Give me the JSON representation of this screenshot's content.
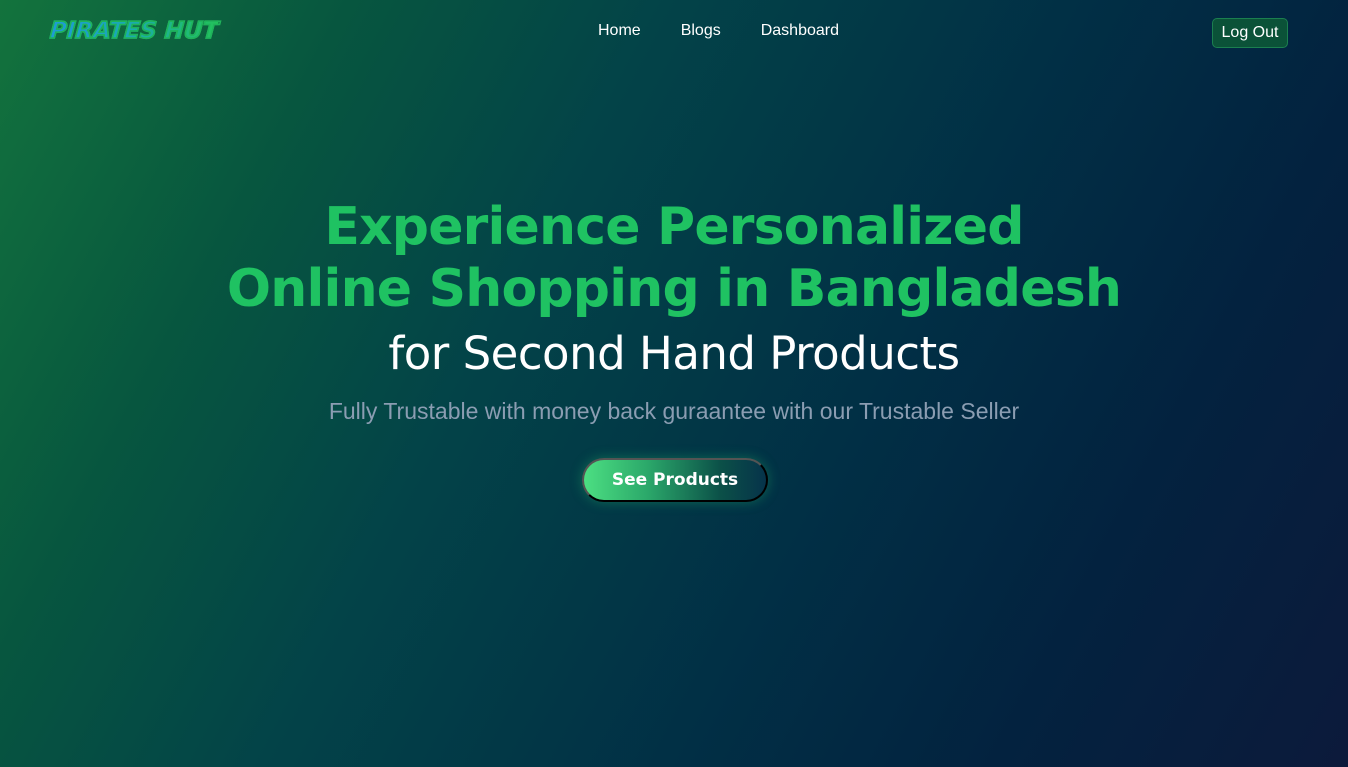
{
  "brand": {
    "logo_text": "PIRATES HUT"
  },
  "nav": {
    "links": [
      {
        "label": "Home"
      },
      {
        "label": "Blogs"
      },
      {
        "label": "Dashboard"
      }
    ],
    "logout_label": "Log Out"
  },
  "hero": {
    "title_line1": "Experience Personalized",
    "title_line2": "Online Shopping in Bangladesh",
    "subtitle": "for Second Hand Products",
    "description": "Fully Trustable with money back guraantee with our Trustable Seller",
    "cta_label": "See Products"
  },
  "colors": {
    "accent_green": "#1fc262",
    "description_gray": "#8b9db2",
    "bg_start": "#13733d",
    "bg_end": "#0c1a3b"
  }
}
